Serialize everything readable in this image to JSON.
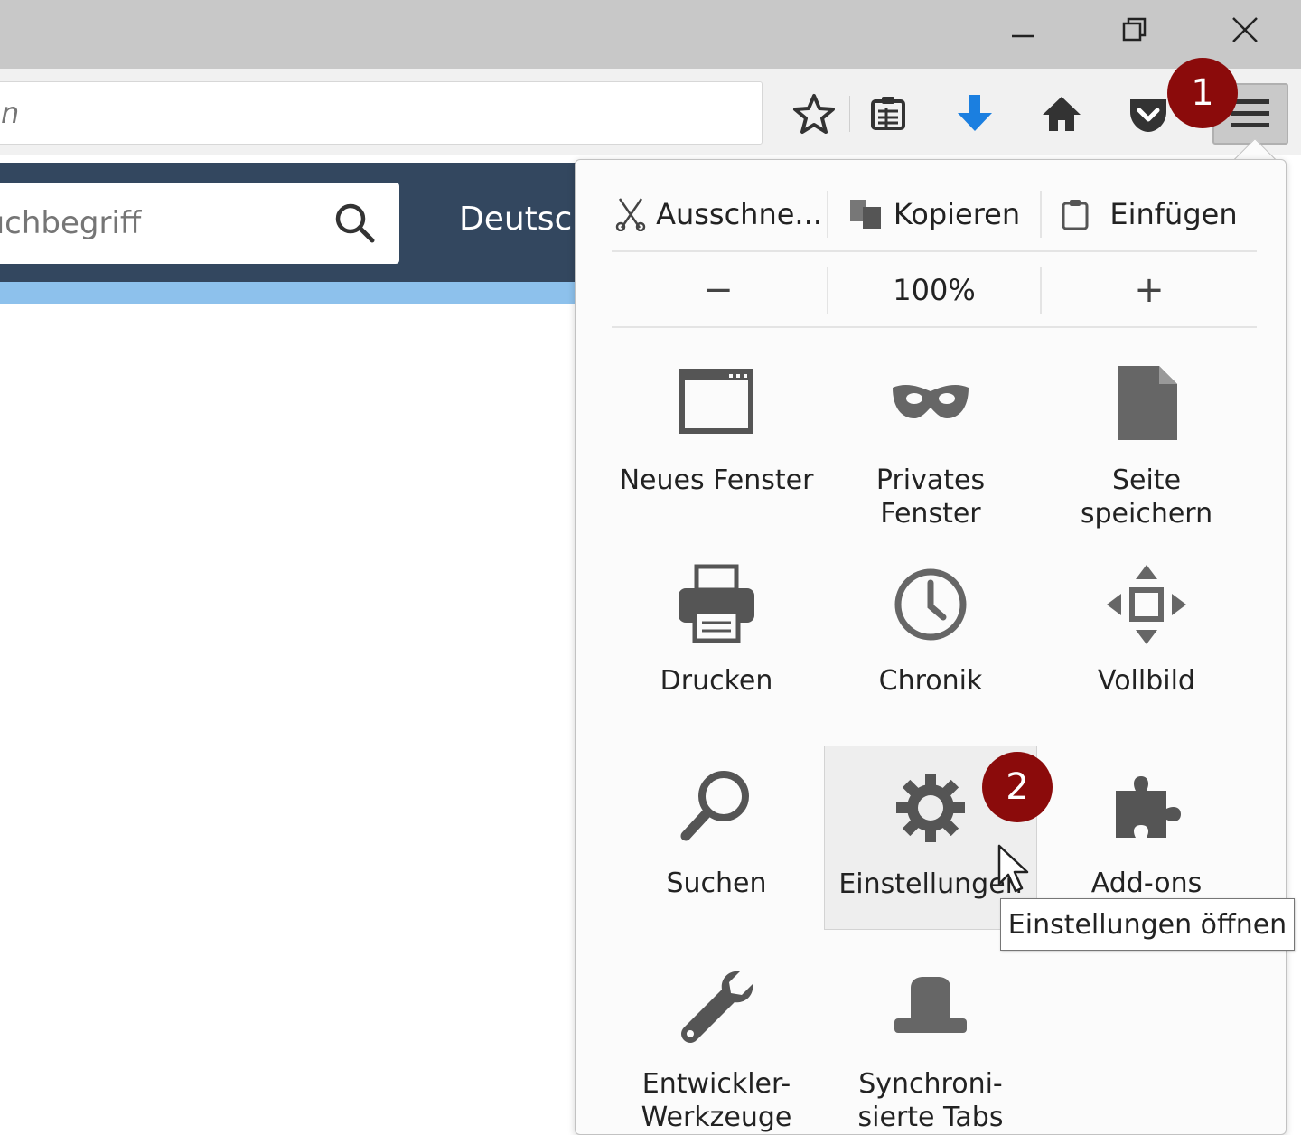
{
  "window_controls": {
    "minimize_icon": "minimize-icon",
    "restore_icon": "restore-icon",
    "close_icon": "close-icon"
  },
  "navbar": {
    "url_placeholder_tail": "ben",
    "icons": [
      "star-icon",
      "reading-list-icon",
      "download-icon",
      "home-icon",
      "pocket-icon",
      "menu-icon"
    ]
  },
  "callouts": {
    "one": "1",
    "two": "2"
  },
  "site": {
    "search_placeholder": "Suchbegriff",
    "lang_link": "Deutsch"
  },
  "panel": {
    "edit": {
      "cut": "Ausschne...",
      "copy": "Kopieren",
      "paste": "Einfügen"
    },
    "zoom": {
      "minus": "−",
      "level": "100%",
      "plus": "+"
    },
    "items": [
      {
        "label_l1": "Neues Fenster",
        "label_l2": ""
      },
      {
        "label_l1": "Privates",
        "label_l2": "Fenster"
      },
      {
        "label_l1": "Seite",
        "label_l2": "speichern"
      },
      {
        "label_l1": "Drucken",
        "label_l2": ""
      },
      {
        "label_l1": "Chronik",
        "label_l2": ""
      },
      {
        "label_l1": "Vollbild",
        "label_l2": ""
      },
      {
        "label_l1": "Suchen",
        "label_l2": ""
      },
      {
        "label_l1": "Einstellungen",
        "label_l2": ""
      },
      {
        "label_l1": "Add-ons",
        "label_l2": ""
      },
      {
        "label_l1": "Entwickler-",
        "label_l2": "Werkzeuge"
      },
      {
        "label_l1": "Synchroni-",
        "label_l2": "sierte Tabs"
      }
    ],
    "tooltip": "Einstellungen öffnen"
  },
  "colors": {
    "callout": "#8b0b0b",
    "site_header": "#33475f",
    "site_strip": "#8dc1ec",
    "download_blue": "#1b7fe0"
  }
}
